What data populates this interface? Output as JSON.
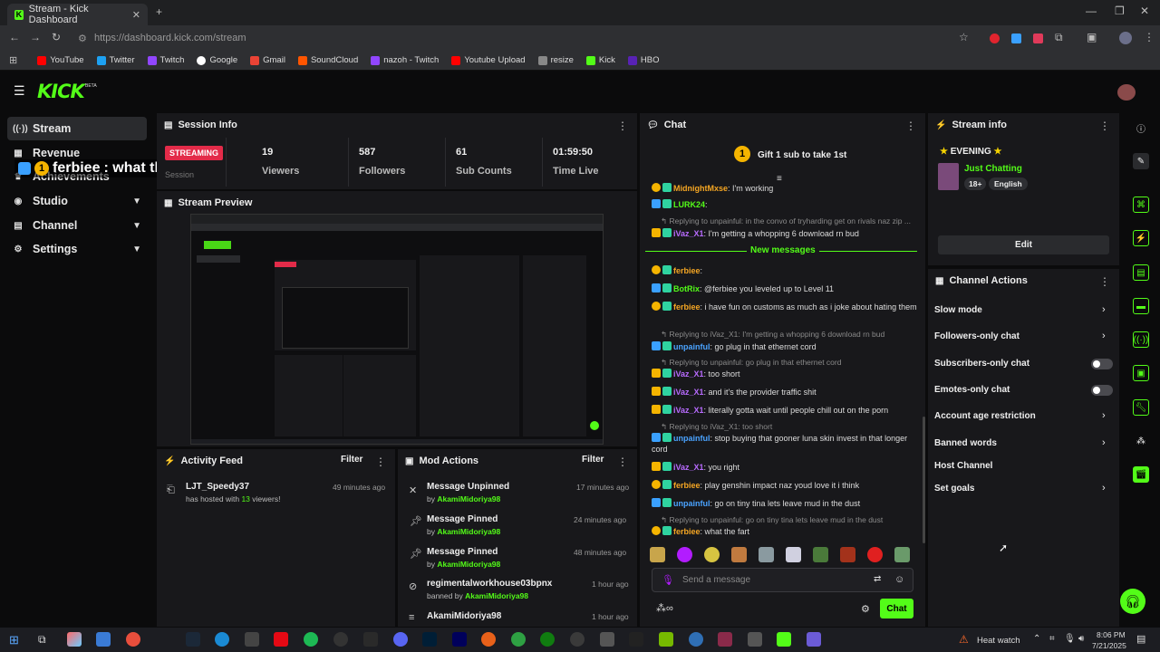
{
  "browser": {
    "tab_title": "Stream - Kick Dashboard",
    "url": "https://dashboard.kick.com/stream",
    "bookmarks": [
      "YouTube",
      "Twitter",
      "Twitch",
      "Google",
      "Gmail",
      "SoundCloud",
      "nazoh - Twitch",
      "Youtube Upload",
      "resize",
      "Kick",
      "HBO"
    ]
  },
  "app": {
    "logo": "KICK",
    "beta": "BETA"
  },
  "sidebar": {
    "items": [
      {
        "label": "Stream"
      },
      {
        "label": "Revenue"
      },
      {
        "label": "Achievements"
      },
      {
        "label": "Studio"
      },
      {
        "label": "Channel"
      },
      {
        "label": "Settings"
      }
    ]
  },
  "overlay_message": {
    "user": "ferbiee",
    "text": ": what the fart",
    "badge": "1"
  },
  "session": {
    "title": "Session Info",
    "status": "STREAMING",
    "status_sub": "Session",
    "stats": [
      {
        "value": "19",
        "label": "Viewers"
      },
      {
        "value": "587",
        "label": "Followers"
      },
      {
        "value": "61",
        "label": "Sub Counts"
      },
      {
        "value": "01:59:50",
        "label": "Time Live"
      }
    ]
  },
  "preview": {
    "title": "Stream Preview"
  },
  "activity": {
    "title": "Activity Feed",
    "filter": "Filter",
    "items": [
      {
        "user": "LJT_Speedy37",
        "pre": "has hosted with ",
        "count": "13",
        "post": " viewers!",
        "time": "49 minutes ago"
      }
    ]
  },
  "mod": {
    "title": "Mod Actions",
    "filter": "Filter",
    "items": [
      {
        "title": "Message Unpinned",
        "by": "by ",
        "user": "AkamiMidoriya98",
        "time": "17 minutes ago"
      },
      {
        "title": "Message Pinned",
        "by": "by ",
        "user": "AkamiMidoriya98",
        "time": "24 minutes ago"
      },
      {
        "title": "Message Pinned",
        "by": "by ",
        "user": "AkamiMidoriya98",
        "time": "48 minutes ago"
      },
      {
        "title": "regimentalworkhouse03bpnx",
        "by": "banned by ",
        "user": "AkamiMidoriya98",
        "time": "1 hour ago"
      },
      {
        "title": "AkamiMidoriya98",
        "by": "",
        "user": "",
        "time": "1 hour ago"
      }
    ]
  },
  "chat": {
    "title": "Chat",
    "pinned": "Gift 1 sub to take 1st",
    "pinned_badge": "1",
    "new_messages": "New messages",
    "input_placeholder": "Send a message",
    "send": "Chat",
    "lines": [
      {
        "type": "msg",
        "user": "MidnightMxse",
        "text": ": I'm working",
        "color": "#f5a623"
      },
      {
        "type": "msg",
        "user": "LURK24",
        "text": ":",
        "color": "#53fc18"
      },
      {
        "type": "reply",
        "text": "Replying to unpainful: in the convo of tryharding get on rivals naz zip ..."
      },
      {
        "type": "msg",
        "user": "iVaz_X1",
        "text": ": I'm getting a whopping 6 download rn bud",
        "color": "#b86bff"
      },
      {
        "type": "msg",
        "user": "ferbiee",
        "text": ":",
        "color": "#f5a623"
      },
      {
        "type": "msg",
        "user": "BotRix",
        "text": ": @ferbiee you leveled up to Level 11",
        "color": "#53fc18"
      },
      {
        "type": "msg",
        "user": "ferbiee",
        "text": ": i have fun on customs as much as i joke about hating them",
        "color": "#f5a623"
      },
      {
        "type": "reply",
        "text": "Replying to iVaz_X1: I'm getting a whopping 6 download rn bud"
      },
      {
        "type": "msg",
        "user": "unpainful",
        "text": ": go plug in that ethernet cord",
        "color": "#4aa3ff"
      },
      {
        "type": "reply",
        "text": "Replying to unpainful: go plug in that ethernet cord"
      },
      {
        "type": "msg",
        "user": "iVaz_X1",
        "text": ": too short",
        "color": "#b86bff"
      },
      {
        "type": "msg",
        "user": "iVaz_X1",
        "text": ": and it's the provider traffic shit",
        "color": "#b86bff"
      },
      {
        "type": "msg",
        "user": "iVaz_X1",
        "text": ": literally gotta wait until people chill out on the porn",
        "color": "#b86bff"
      },
      {
        "type": "reply",
        "text": "Replying to iVaz_X1: too short"
      },
      {
        "type": "msg",
        "user": "unpainful",
        "text": ": stop buying that gooner luna skin invest in that longer cord",
        "color": "#4aa3ff"
      },
      {
        "type": "msg",
        "user": "iVaz_X1",
        "text": ": you right",
        "color": "#b86bff"
      },
      {
        "type": "msg",
        "user": "ferbiee",
        "text": ": play genshin impact naz youd love it i think",
        "color": "#f5a623"
      },
      {
        "type": "msg",
        "user": "unpainful",
        "text": ": go on tiny tina lets leave mud in the dust",
        "color": "#4aa3ff"
      },
      {
        "type": "reply",
        "text": "Replying to unpainful: go on tiny tina lets leave mud in the dust"
      },
      {
        "type": "msg",
        "user": "ferbiee",
        "text": ": what the fart",
        "color": "#f5a623"
      }
    ]
  },
  "stream_info": {
    "title": "Stream info",
    "stream_title": "EVENING",
    "category": "Just Chatting",
    "tags": [
      "18+",
      "English"
    ],
    "edit": "Edit"
  },
  "channel_actions": {
    "title": "Channel Actions",
    "items": [
      {
        "label": "Slow mode",
        "control": "arrow"
      },
      {
        "label": "Followers-only chat",
        "control": "arrow"
      },
      {
        "label": "Subscribers-only chat",
        "control": "toggle"
      },
      {
        "label": "Emotes-only chat",
        "control": "toggle"
      },
      {
        "label": "Account age restriction",
        "control": "arrow"
      },
      {
        "label": "Banned words",
        "control": "arrow"
      },
      {
        "label": "Host Channel",
        "control": "none"
      },
      {
        "label": "Set goals",
        "control": "arrow"
      }
    ]
  },
  "taskbar": {
    "weather": "Heat watch",
    "time": "8:06 PM",
    "date": "7/21/2025"
  },
  "colors": {
    "accent": "#53fc18",
    "panel": "#18181b",
    "streaming": "#e32b49"
  }
}
